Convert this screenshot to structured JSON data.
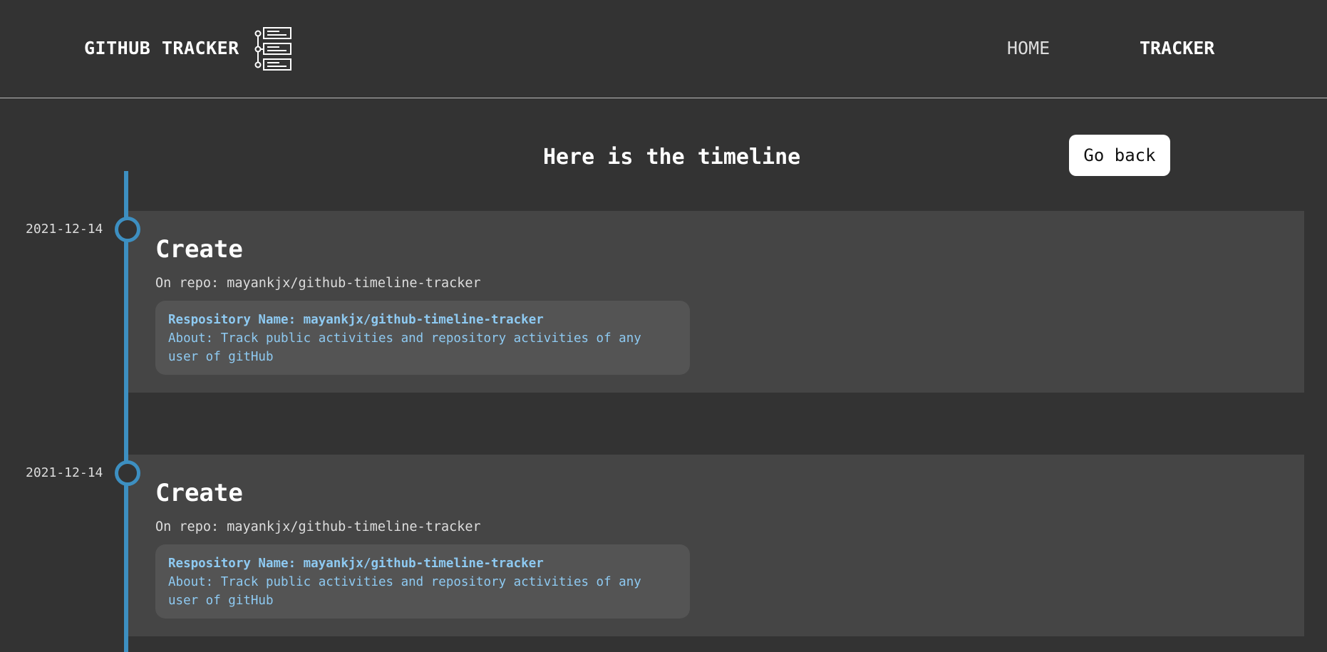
{
  "navbar": {
    "brand": "GITHUB TRACKER",
    "logo_icon": "timeline-list-icon",
    "links": [
      {
        "label": "HOME",
        "active": false
      },
      {
        "label": "TRACKER",
        "active": true
      }
    ]
  },
  "main": {
    "heading": "Here is the timeline",
    "go_back_label": "Go back",
    "accent_color": "#3d8fc1",
    "events": [
      {
        "date": "2021-12-14",
        "type": "Create",
        "repo_line": "On repo: mayankjx/github-timeline-tracker",
        "repo_name_line": "Respository Name: mayankjx/github-timeline-tracker",
        "about_line": "About: Track public activities and repository activities of any user of gitHub"
      },
      {
        "date": "2021-12-14",
        "type": "Create",
        "repo_line": "On repo: mayankjx/github-timeline-tracker",
        "repo_name_line": "Respository Name: mayankjx/github-timeline-tracker",
        "about_line": "About: Track public activities and repository activities of any user of gitHub"
      }
    ]
  }
}
